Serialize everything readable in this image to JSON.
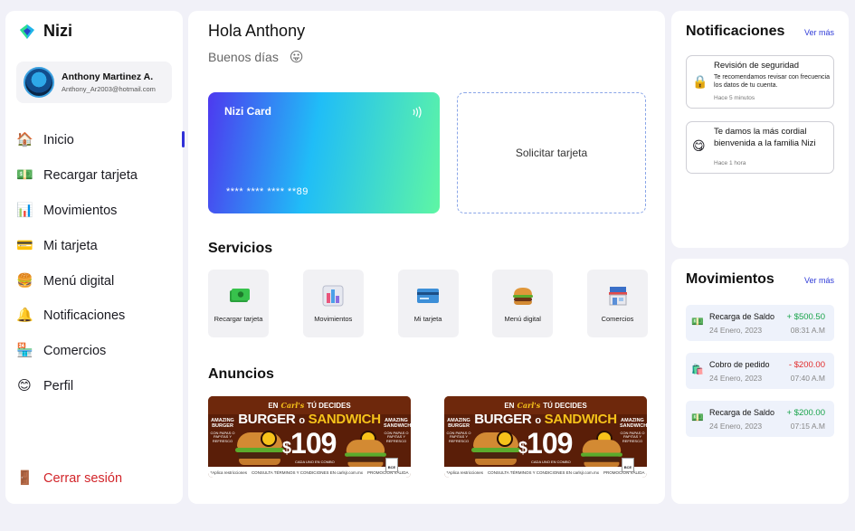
{
  "app": {
    "name": "Nizi",
    "brand_colors": [
      "#1fb4e8",
      "#2ee28f",
      "#2446c8"
    ]
  },
  "user": {
    "name": "Anthony Martinez A.",
    "email": "Anthony_Ar2003@hotmail.com"
  },
  "sidebar": {
    "items": [
      {
        "label": "Inicio",
        "icon": "house-icon",
        "active": true
      },
      {
        "label": "Recargar tarjeta",
        "icon": "money-icon",
        "active": false
      },
      {
        "label": "Movimientos",
        "icon": "bar-chart-icon",
        "active": false
      },
      {
        "label": "Mi tarjeta",
        "icon": "credit-card-icon",
        "active": false
      },
      {
        "label": "Menú digital",
        "icon": "burger-icon",
        "active": false
      },
      {
        "label": "Notificaciones",
        "icon": "bell-icon",
        "active": false
      },
      {
        "label": "Comercios",
        "icon": "store-icon",
        "active": false
      },
      {
        "label": "Perfil",
        "icon": "smiley-icon",
        "active": false
      }
    ],
    "logout_label": "Cerrar sesión",
    "active_color": "#2f2fd8",
    "logout_color": "#d2252a"
  },
  "main": {
    "greeting": "Hola Anthony",
    "subgreeting": "Buenos días",
    "card": {
      "title": "Nizi Card",
      "number": "**** **** **** **89"
    },
    "request_card_label": "Solicitar tarjeta",
    "services_title": "Servicios",
    "services": [
      {
        "label": "Recargar tarjeta",
        "icon": "money-icon"
      },
      {
        "label": "Movimientos",
        "icon": "bar-chart-icon"
      },
      {
        "label": "Mi tarjeta",
        "icon": "credit-card-icon"
      },
      {
        "label": "Menú digital",
        "icon": "burger-icon"
      },
      {
        "label": "Comercios",
        "icon": "store-icon"
      }
    ],
    "ads_title": "Anuncios",
    "ads": [
      {
        "top_prefix": "EN",
        "brand": "Carl's",
        "top_suffix": "TÚ DECIDES",
        "headline_a": "BURGER",
        "headline_o": "o",
        "headline_b": "SANDWICH",
        "left_title": "AMAZING BURGER",
        "left_small": "CON PAPAS O PAPITAS Y REFRESCO",
        "right_title": "AMAZING SANDWICH",
        "right_small": "CON PAPAS O PAPITAS Y REFRESCO",
        "price_currency": "$",
        "price": "109",
        "price_sub": "CADA UNO EN COMBO",
        "footer_left": "*Aplica restricciones",
        "footer_center": "CONSULTA TÉRMINOS Y CONDICIONES EN carlsjr.com.mx",
        "footer_right": "PROMOCIÓN VÁLIDA",
        "tag": "BCE"
      },
      {
        "top_prefix": "EN",
        "brand": "Carl's",
        "top_suffix": "TÚ DECIDES",
        "headline_a": "BURGER",
        "headline_o": "o",
        "headline_b": "SANDWICH",
        "left_title": "AMAZING BURGER",
        "left_small": "CON PAPAS O PAPITAS Y REFRESCO",
        "right_title": "AMAZING SANDWICH",
        "right_small": "CON PAPAS O PAPITAS Y REFRESCO",
        "price_currency": "$",
        "price": "109",
        "price_sub": "CADA UNO EN COMBO",
        "footer_left": "*Aplica restricciones",
        "footer_center": "CONSULTA TÉRMINOS Y CONDICIONES EN carlsjr.com.mx",
        "footer_right": "PROMOCIÓN VÁLIDA",
        "tag": "BCE"
      }
    ]
  },
  "notifications": {
    "title": "Notificaciones",
    "more_label": "Ver más",
    "items": [
      {
        "icon": "padlock-icon",
        "title": "Revisión de seguridad",
        "description": "Te recomendamos revisar con frecuencia los datos de tu cuenta.",
        "time": "Hace 5 minutos"
      },
      {
        "icon": "smiley-icon",
        "title": "Te damos la más cordial bienvenida a la familia Nizi",
        "description": "",
        "time": "Hace 1 hora"
      }
    ]
  },
  "movements": {
    "title": "Movimientos",
    "more_label": "Ver más",
    "items": [
      {
        "icon": "money-icon",
        "title": "Recarga de Saldo",
        "date": "24 Enero, 2023",
        "amount": "+ $500.50",
        "time": "08:31 A.M",
        "type": "pos"
      },
      {
        "icon": "shopping-bags-icon",
        "title": "Cobro de pedido",
        "date": "24 Enero, 2023",
        "amount": "- $200.00",
        "time": "07:40 A.M",
        "type": "neg"
      },
      {
        "icon": "money-icon",
        "title": "Recarga de Saldo",
        "date": "24 Enero, 2023",
        "amount": "+ $200.00",
        "time": "07:15 A.M",
        "type": "pos"
      }
    ]
  }
}
